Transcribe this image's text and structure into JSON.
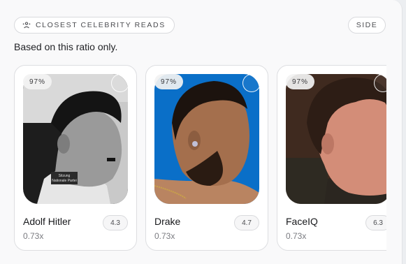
{
  "header": {
    "title": "CLOSEST CELEBRITY READS",
    "title_icon": "people-icon",
    "side_label": "SIDE"
  },
  "subtitle": "Based on this ratio only.",
  "cards": [
    {
      "name": "Adolf Hitler",
      "ratio": "0.73x",
      "score": "4.3",
      "match": "97%",
      "label_text": [
        "Sitzung",
        "Nationale Partei"
      ]
    },
    {
      "name": "Drake",
      "ratio": "0.73x",
      "score": "4.7",
      "match": "97%"
    },
    {
      "name": "FaceIQ",
      "ratio": "0.73x",
      "score": "6.3",
      "match": "97%"
    }
  ],
  "colors": {
    "card_bg": "#ffffff",
    "drake_photo_bg": "#0a6fc8",
    "faceiq_photo_bg": "#3f2a1f"
  }
}
